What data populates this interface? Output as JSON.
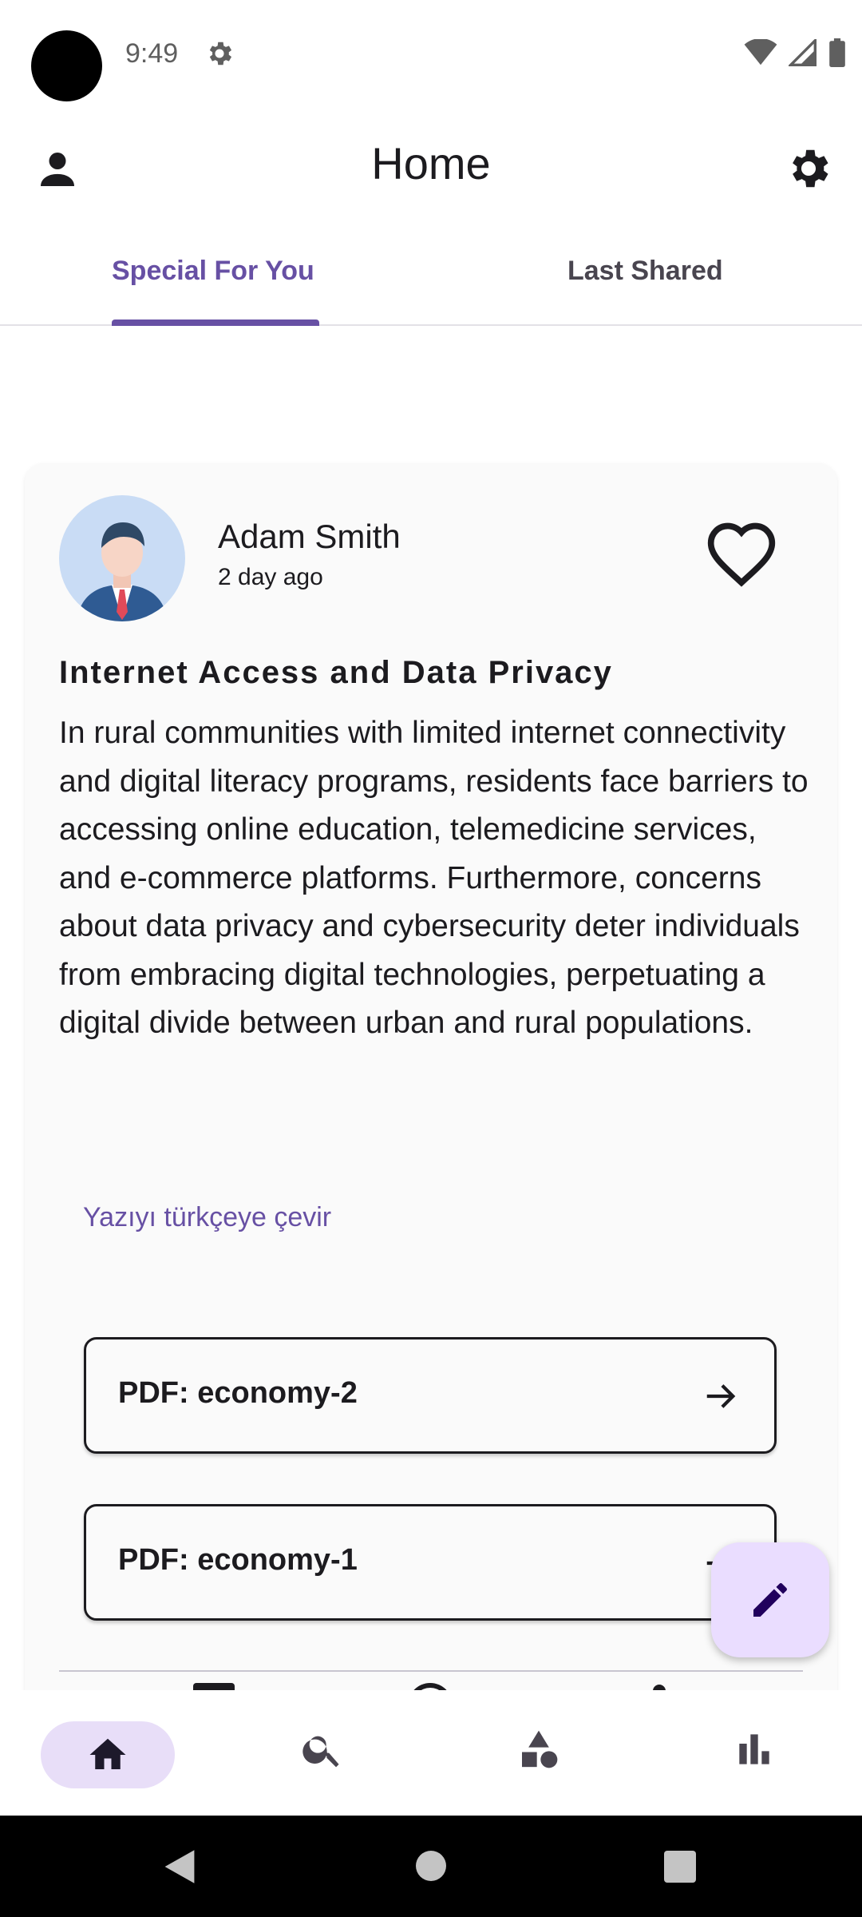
{
  "status_bar": {
    "time": "9:49"
  },
  "app_bar": {
    "title": "Home"
  },
  "tabs": [
    {
      "label": "Special For You",
      "selected": true
    },
    {
      "label": "Last Shared",
      "selected": false
    }
  ],
  "post": {
    "author": "Adam Smith",
    "time": "2 day ago",
    "title": "Internet Access and Data Privacy",
    "body": "In rural communities with limited internet connectivity and digital literacy programs, residents face barriers to accessing online education, telemedicine services, and e-commerce platforms. Furthermore, concerns about data privacy and cybersecurity deter individuals from embracing digital technologies, perpetuating a digital divide between urban and rural populations.",
    "translate_link": "Yazıyı türkçeye çevir",
    "attachments": [
      {
        "label": "PDF: economy-2"
      },
      {
        "label": "PDF: economy-1"
      }
    ]
  },
  "bottom_nav": {
    "items": [
      "home-icon",
      "search-icon",
      "shapes-icon",
      "bar-chart-icon"
    ],
    "selected": "home-icon"
  },
  "colors": {
    "accent": "#6750a4",
    "fab_bg": "#eaddff",
    "nav_pill": "#e8def8"
  }
}
